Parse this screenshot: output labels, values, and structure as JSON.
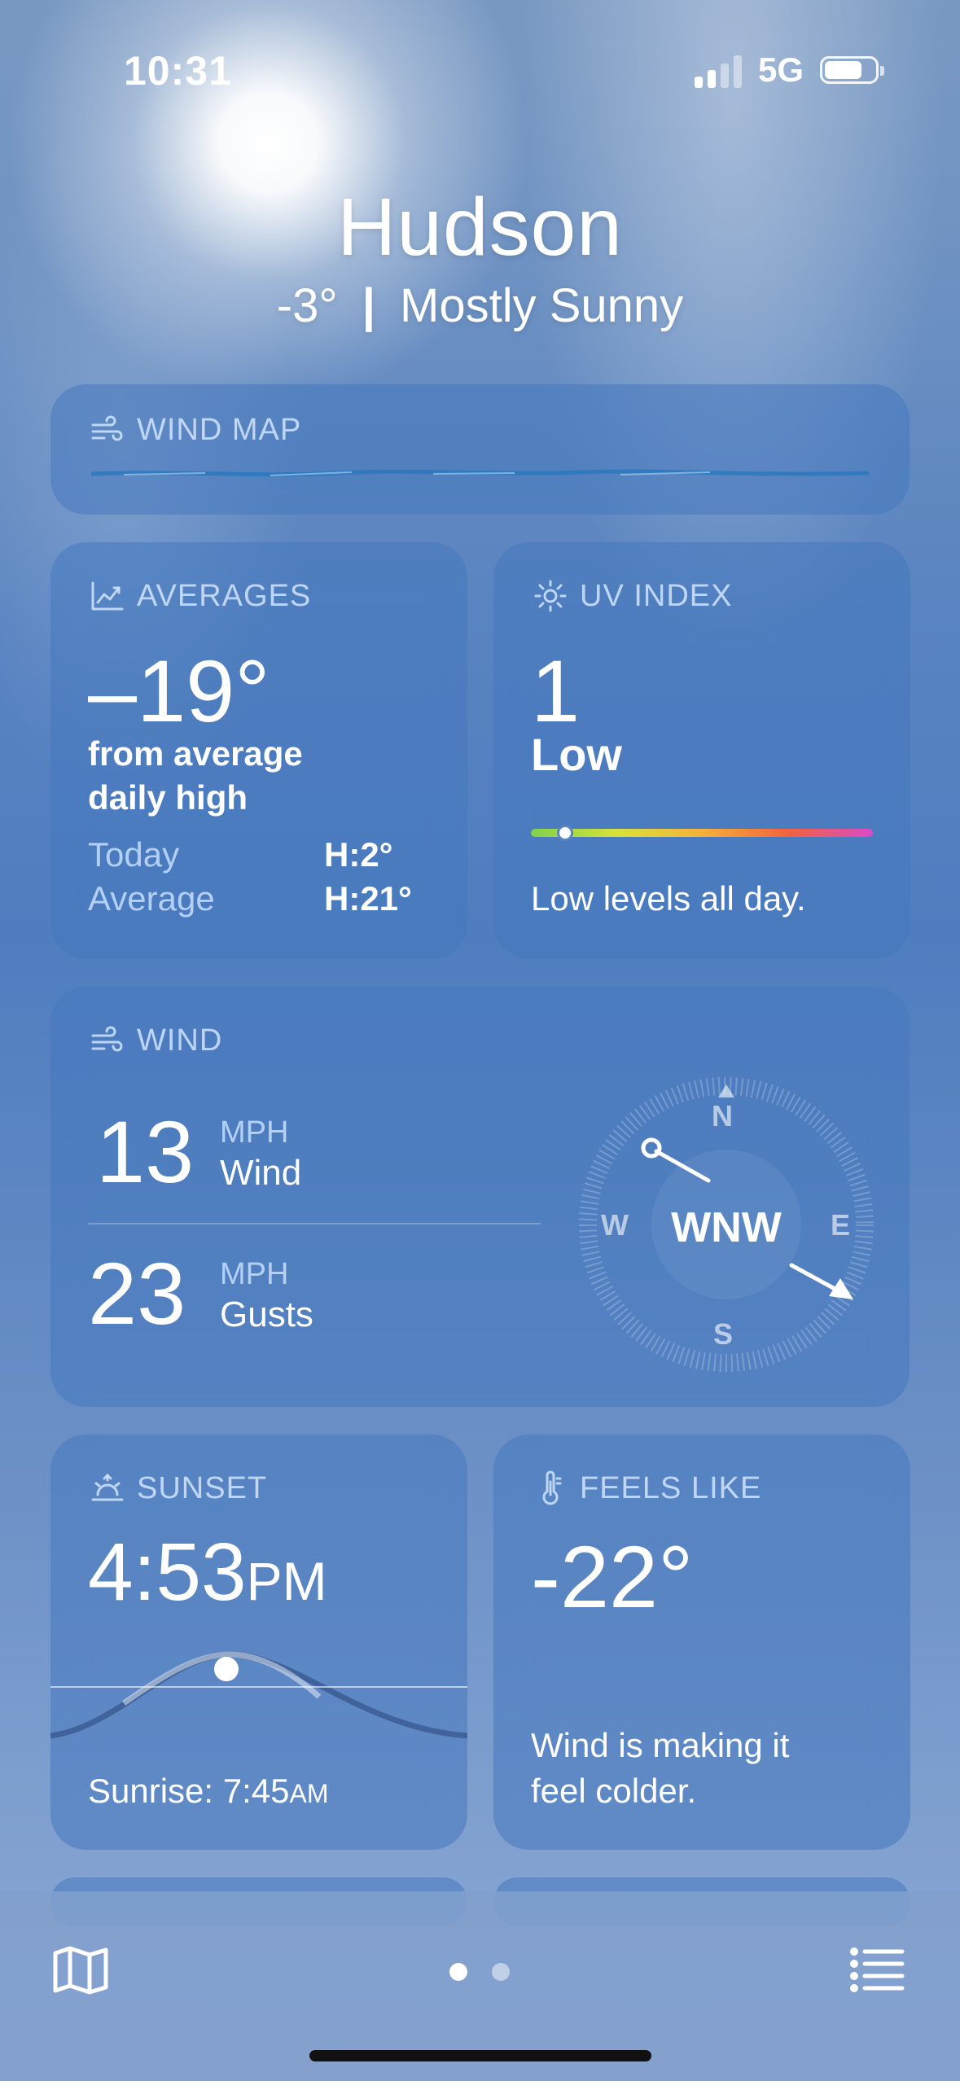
{
  "status": {
    "time": "10:31",
    "network": "5G",
    "battery_level": 0.75
  },
  "header": {
    "city": "Hudson",
    "temperature": "-3°",
    "separator": "|",
    "condition": "Mostly Sunny"
  },
  "wind_map": {
    "title": "WIND MAP"
  },
  "averages": {
    "title": "AVERAGES",
    "delta": "–19°",
    "desc_line1": "from average",
    "desc_line2": "daily high",
    "today_label": "Today",
    "today_value": "H:2°",
    "average_label": "Average",
    "average_value": "H:21°"
  },
  "uv": {
    "title": "UV INDEX",
    "value": "1",
    "level": "Low",
    "level_fraction": 0.1,
    "summary": "Low levels all day."
  },
  "wind": {
    "title": "WIND",
    "speed": "13",
    "speed_unit": "MPH",
    "speed_label": "Wind",
    "gusts": "23",
    "gusts_unit": "MPH",
    "gusts_label": "Gusts",
    "direction": "WNW",
    "compass": {
      "n": "N",
      "e": "E",
      "s": "S",
      "w": "W"
    }
  },
  "sunset": {
    "title": "SUNSET",
    "time": "4:53",
    "time_suffix": "PM",
    "sunrise_label": "Sunrise: 7:45",
    "sunrise_suffix": "AM"
  },
  "feels_like": {
    "title": "FEELS LIKE",
    "value": "-22°",
    "line1": "Wind is making it",
    "line2": "feel colder."
  },
  "page_indicator": {
    "pages": 2,
    "active": 1
  }
}
